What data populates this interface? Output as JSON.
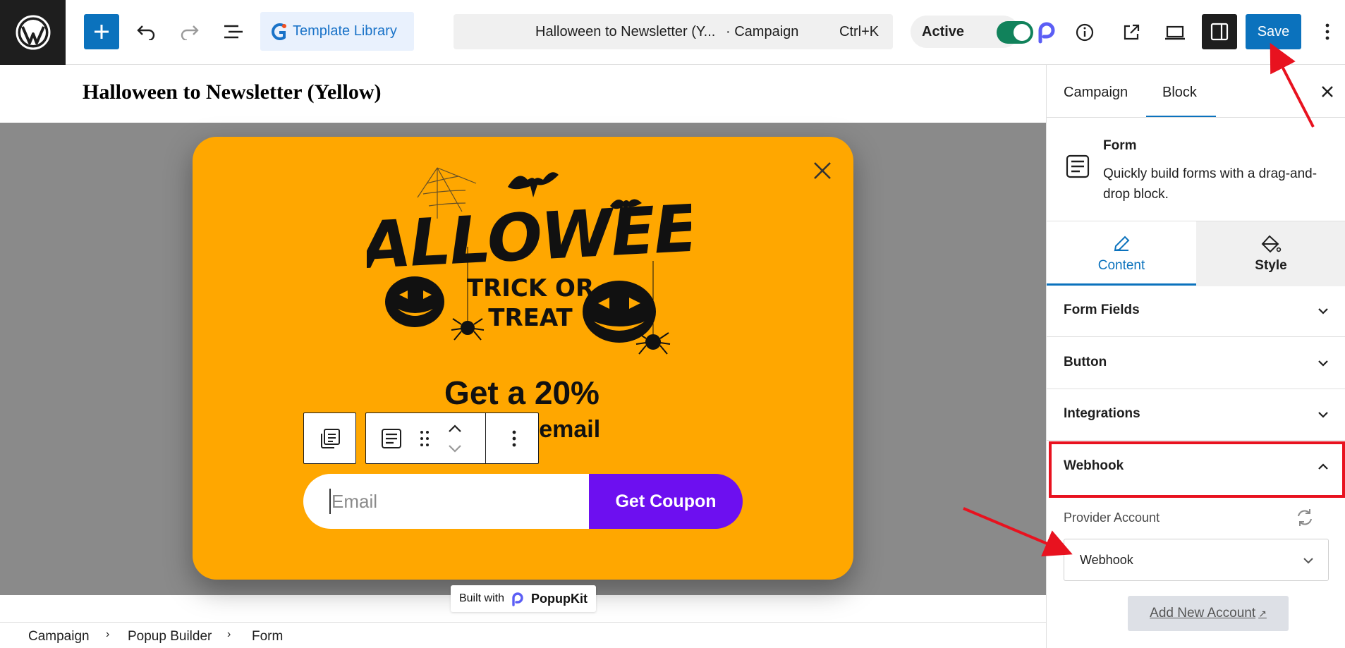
{
  "topbar": {
    "template_library_label": "Template Library",
    "command_title": "Halloween to Newsletter (Y...",
    "command_type": "· Campaign",
    "command_shortcut": "Ctrl+K",
    "status_label": "Active",
    "status_on": true,
    "save_label": "Save"
  },
  "editor": {
    "post_title": "Halloween to Newsletter (Yellow)",
    "popup": {
      "headline": "Get a 20%",
      "subline": "our email",
      "email_placeholder": "Email",
      "cta_label": "Get Coupon",
      "bg_color": "#ffa700",
      "cta_color": "#6d0ff0"
    },
    "built_with_prefix": "Built with",
    "built_with_brand": "PopupKit"
  },
  "breadcrumb": [
    "Campaign",
    "Popup Builder",
    "Form"
  ],
  "sidebar": {
    "tabs": [
      "Campaign",
      "Block"
    ],
    "active_tab": "Block",
    "block": {
      "name": "Form",
      "description": "Quickly build forms with a drag-and-drop block."
    },
    "content_tabs": [
      "Content",
      "Style"
    ],
    "panels": [
      "Form Fields",
      "Button",
      "Integrations",
      "Webhook"
    ],
    "provider_label": "Provider Account",
    "provider_value": "Webhook",
    "add_account_label": "Add New Account",
    "add_account_icon": "↗"
  },
  "colors": {
    "accent": "#0b72bd",
    "toggle_on": "#11825b",
    "highlight": "#e8121f"
  }
}
